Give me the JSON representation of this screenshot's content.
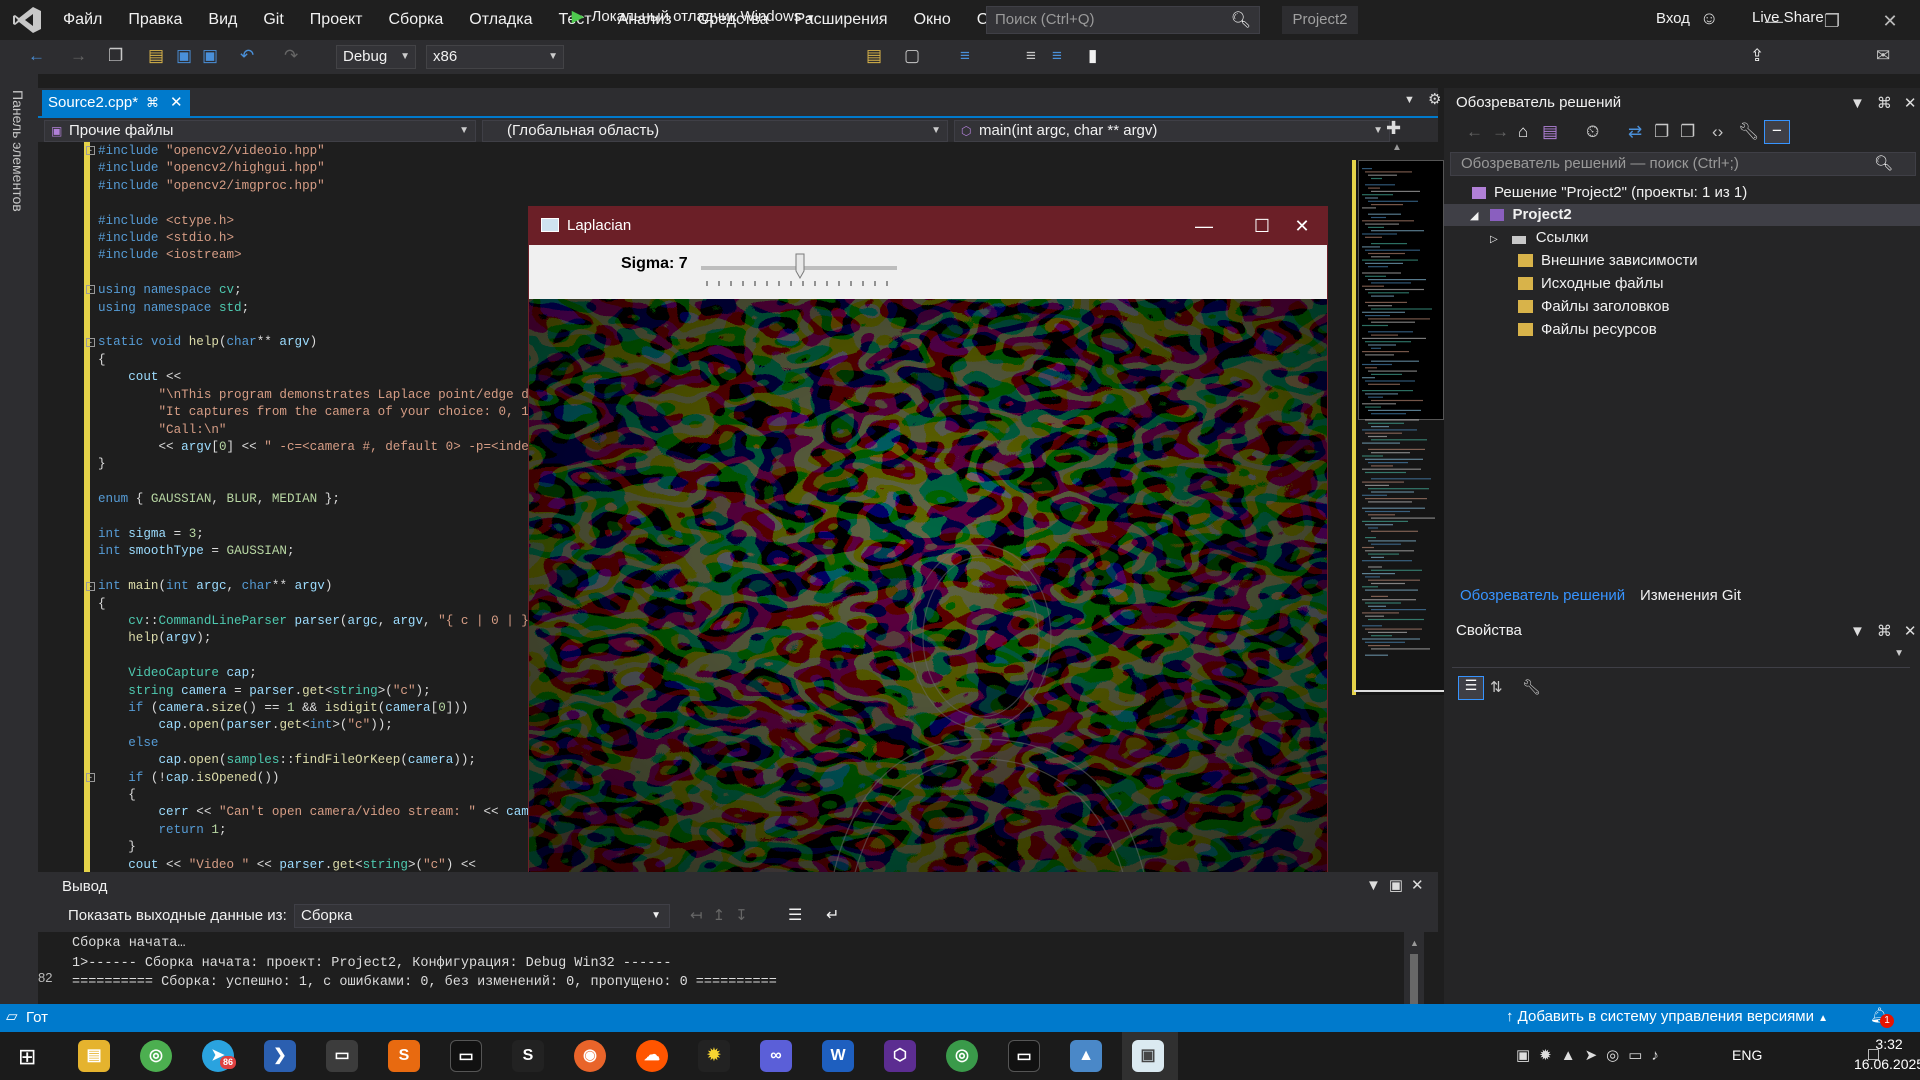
{
  "menu": {
    "items": [
      "Файл",
      "Правка",
      "Вид",
      "Git",
      "Проект",
      "Сборка",
      "Отладка",
      "Тест",
      "Анализ",
      "Средства",
      "Расширения",
      "Окно",
      "Справка"
    ],
    "search_placeholder": "Поиск (Ctrl+Q)",
    "project_badge": "Project2",
    "signin": "Вход"
  },
  "toolbar": {
    "config": "Debug",
    "platform": "x86",
    "run_label": "Локальный отладчик Windows",
    "live_share": "Live Share"
  },
  "side_panel": {
    "label": "Панель элементов"
  },
  "editor": {
    "tab_label": "Source2.cpp*",
    "nav_project": "Прочие файлы",
    "nav_scope": "(Глобальная область)",
    "nav_member": "main(int argc, char ** argv)"
  },
  "laplacian": {
    "title": "Laplacian",
    "sigma_label": "Sigma: 7",
    "sigma_value": 7,
    "sigma_fraction": 0.5
  },
  "output": {
    "title": "Вывод",
    "show_label": "Показать выходные данные из:",
    "source": "Сборка",
    "zoom": "82",
    "lines": [
      "Сборка начата…",
      "1>------ Сборка начата: проект: Project2, Конфигурация: Debug Win32 ------",
      "========== Сборка: успешно: 1, с ошибками: 0, без изменений: 0, пропущено: 0 =========="
    ]
  },
  "status": {
    "text": "Гот",
    "vcs": "Добавить в систему управления версиями",
    "notifications": "1"
  },
  "solution_explorer": {
    "title": "Обозреватель решений",
    "search_placeholder": "Обозреватель решений — поиск (Ctrl+;)",
    "solution": "Решение \"Project2\" (проекты: 1 из 1)",
    "project": "Project2",
    "items": [
      "Ссылки",
      "Внешние зависимости",
      "Исходные файлы",
      "Файлы заголовков",
      "Файлы ресурсов"
    ],
    "tab_active": "Обозреватель решений",
    "tab_other": "Изменения Git"
  },
  "properties": {
    "title": "Свойства"
  },
  "taskbar": {
    "lang": "ENG",
    "time": "3:32",
    "date": "16.06.2025",
    "telegram_badge": "86"
  },
  "colors": {
    "accent": "#007acc",
    "laplacian_title": "#6b1f27",
    "yellow_marker": "#e5d349"
  }
}
